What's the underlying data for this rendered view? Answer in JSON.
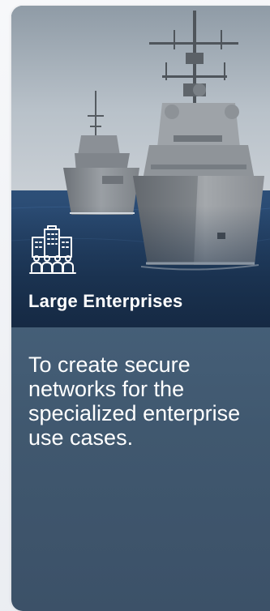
{
  "card": {
    "icon": "enterprise-building-people-icon",
    "title": "Large Enterprises",
    "description": "To create secure networks for the specialized enterprise use cases."
  },
  "colors": {
    "card_background": "#4a6580",
    "text": "#ffffff",
    "sea": "#25456b",
    "sky": "#b9c3cc"
  }
}
